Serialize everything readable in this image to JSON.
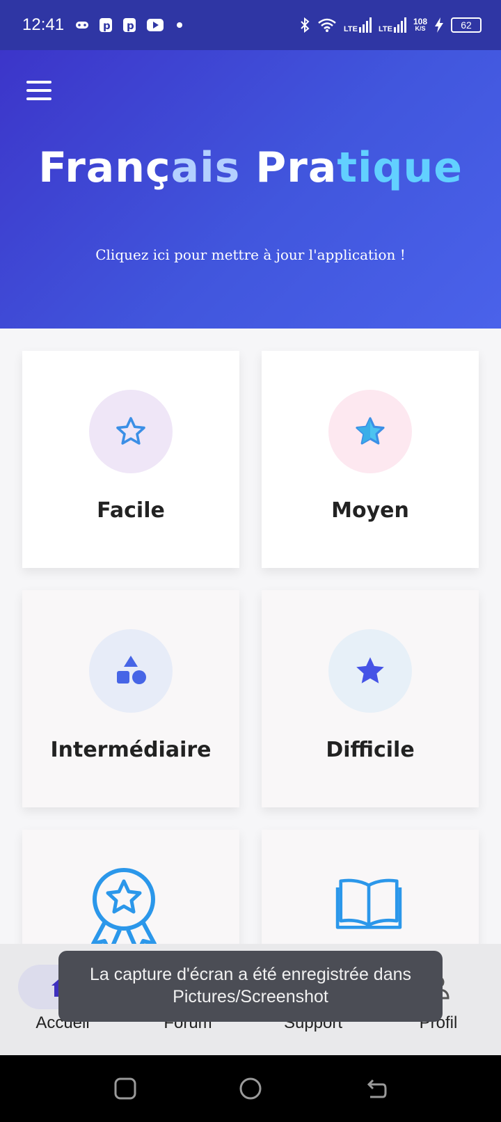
{
  "status_bar": {
    "time": "12:41",
    "network_1": "LTE",
    "network_2": "LTE",
    "speed_value": "108",
    "speed_unit": "K/S",
    "battery": "62"
  },
  "header": {
    "title_part1": "Franç",
    "title_part2": "ais",
    "title_part3": " Pra",
    "title_part4": "tique",
    "update_link": "Cliquez ici pour mettre à jour l'application !"
  },
  "levels": [
    {
      "label": "Facile",
      "icon": "star-outline-icon",
      "circle_color": "#efe6f7"
    },
    {
      "label": "Moyen",
      "icon": "star-half-icon",
      "circle_color": "#fde8f0"
    },
    {
      "label": "Intermédiaire",
      "icon": "shapes-icon",
      "circle_color": "#e7ecf8"
    },
    {
      "label": "Difficile",
      "icon": "star-filled-icon",
      "circle_color": "#e7f0f8"
    },
    {
      "label": "",
      "icon": "award-ribbon-icon"
    },
    {
      "label": "",
      "icon": "open-book-icon"
    }
  ],
  "bottom_nav": {
    "home": "Accueil",
    "forum": "Forum",
    "support": "Support",
    "profile": "Profil"
  },
  "toast": {
    "line1": "La capture d'écran a été enregistrée dans",
    "line2": "Pictures/Screenshot"
  }
}
